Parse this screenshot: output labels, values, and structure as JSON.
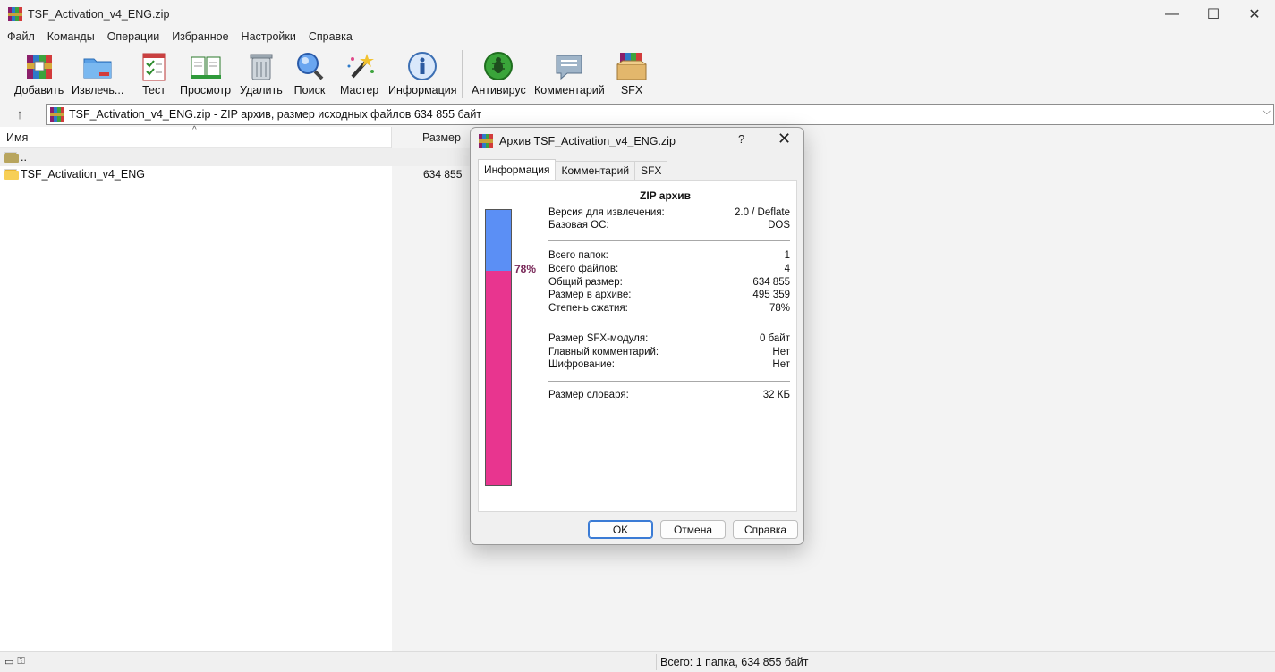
{
  "window": {
    "title": "TSF_Activation_v4_ENG.zip",
    "controls": [
      "—",
      "☐",
      "✕"
    ]
  },
  "menu": [
    "Файл",
    "Команды",
    "Операции",
    "Избранное",
    "Настройки",
    "Справка"
  ],
  "toolbar": [
    {
      "label": "Добавить",
      "icon": "add-archive-icon"
    },
    {
      "label": "Извлечь...",
      "icon": "extract-folder-icon"
    },
    {
      "label": "Тест",
      "icon": "test-checklist-icon"
    },
    {
      "label": "Просмотр",
      "icon": "view-book-icon"
    },
    {
      "label": "Удалить",
      "icon": "trash-bin-icon"
    },
    {
      "label": "Поиск",
      "icon": "search-magnifier-icon"
    },
    {
      "label": "Мастер",
      "icon": "wizard-wand-icon"
    },
    {
      "label": "Информация",
      "icon": "info-icon"
    },
    {
      "label": "Антивирус",
      "icon": "antivirus-bug-icon"
    },
    {
      "label": "Комментарий",
      "icon": "comment-icon"
    },
    {
      "label": "SFX",
      "icon": "sfx-box-icon"
    }
  ],
  "address": {
    "text": "TSF_Activation_v4_ENG.zip - ZIP архив, размер исходных файлов 634 855 байт"
  },
  "list": {
    "col_name": "Имя",
    "col_size": "Размер",
    "rows": [
      {
        "name": "..",
        "size": ""
      },
      {
        "name": "TSF_Activation_v4_ENG",
        "size": "634 855"
      }
    ]
  },
  "status": {
    "text": "Всего: 1 папка, 634 855 байт"
  },
  "dialog": {
    "title": "Архив TSF_Activation_v4_ENG.zip",
    "help": "?",
    "close": "✕",
    "tabs": [
      "Информация",
      "Комментарий",
      "SFX"
    ],
    "active_tab": "Информация",
    "format": "ZIP архив",
    "ratio_label": "78%",
    "ratio_value": 0.78,
    "rows_group1": [
      {
        "k": "Версия для извлечения:",
        "v": "2.0 / Deflate"
      },
      {
        "k": "Базовая ОС:",
        "v": "DOS"
      }
    ],
    "rows_group2": [
      {
        "k": "Всего папок:",
        "v": "1"
      },
      {
        "k": "Всего файлов:",
        "v": "4"
      },
      {
        "k": "Общий размер:",
        "v": "634 855"
      },
      {
        "k": "Размер в архиве:",
        "v": "495 359"
      },
      {
        "k": "Степень сжатия:",
        "v": "78%"
      }
    ],
    "rows_group3": [
      {
        "k": "Размер SFX-модуля:",
        "v": "0 байт"
      },
      {
        "k": "Главный комментарий:",
        "v": "Нет"
      },
      {
        "k": "Шифрование:",
        "v": "Нет"
      }
    ],
    "rows_group4": [
      {
        "k": "Размер словаря:",
        "v": "32 КБ"
      }
    ],
    "buttons": {
      "ok": "OK",
      "cancel": "Отмена",
      "help": "Справка"
    },
    "colors": {
      "compressed": "#e8358f",
      "saved": "#5b8ff5"
    }
  }
}
